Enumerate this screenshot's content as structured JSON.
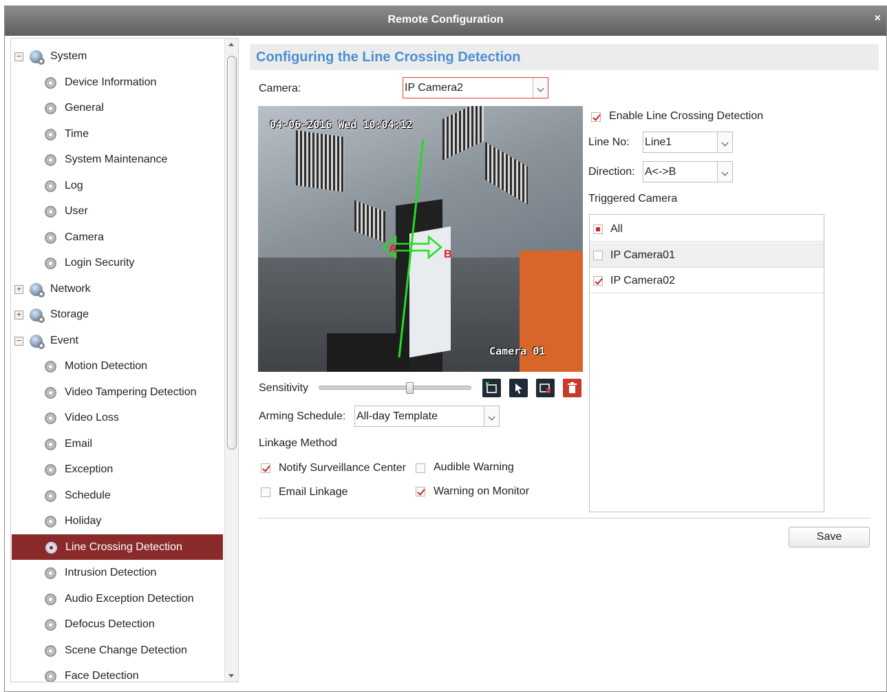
{
  "window": {
    "title": "Remote Configuration",
    "close_label": "×"
  },
  "tree": {
    "items": [
      {
        "label": "System",
        "level": 0,
        "expander": "−",
        "icon": "network-globe-icon"
      },
      {
        "label": "Device Information",
        "level": 1,
        "icon": "settings-gear-icon"
      },
      {
        "label": "General",
        "level": 1,
        "icon": "settings-gear-icon"
      },
      {
        "label": "Time",
        "level": 1,
        "icon": "settings-gear-icon"
      },
      {
        "label": "System Maintenance",
        "level": 1,
        "icon": "settings-gear-icon"
      },
      {
        "label": "Log",
        "level": 1,
        "icon": "settings-gear-icon"
      },
      {
        "label": "User",
        "level": 1,
        "icon": "settings-gear-icon"
      },
      {
        "label": "Camera",
        "level": 1,
        "icon": "settings-gear-icon"
      },
      {
        "label": "Login Security",
        "level": 1,
        "icon": "settings-gear-icon"
      },
      {
        "label": "Network",
        "level": 0,
        "expander": "+",
        "icon": "network-globe-icon"
      },
      {
        "label": "Storage",
        "level": 0,
        "expander": "+",
        "icon": "network-globe-icon"
      },
      {
        "label": "Event",
        "level": 0,
        "expander": "−",
        "icon": "network-globe-icon"
      },
      {
        "label": "Motion Detection",
        "level": 1,
        "icon": "settings-gear-icon"
      },
      {
        "label": "Video Tampering Detection",
        "level": 1,
        "icon": "settings-gear-icon"
      },
      {
        "label": "Video Loss",
        "level": 1,
        "icon": "settings-gear-icon"
      },
      {
        "label": "Email",
        "level": 1,
        "icon": "settings-gear-icon"
      },
      {
        "label": "Exception",
        "level": 1,
        "icon": "settings-gear-icon"
      },
      {
        "label": "Schedule",
        "level": 1,
        "icon": "settings-gear-icon"
      },
      {
        "label": "Holiday",
        "level": 1,
        "icon": "settings-gear-icon"
      },
      {
        "label": "Line Crossing Detection",
        "level": 1,
        "icon": "settings-gear-icon",
        "selected": true
      },
      {
        "label": "Intrusion Detection",
        "level": 1,
        "icon": "settings-gear-icon"
      },
      {
        "label": "Audio Exception Detection",
        "level": 1,
        "icon": "settings-gear-icon"
      },
      {
        "label": "Defocus Detection",
        "level": 1,
        "icon": "settings-gear-icon"
      },
      {
        "label": "Scene Change Detection",
        "level": 1,
        "icon": "settings-gear-icon"
      },
      {
        "label": "Face Detection",
        "level": 1,
        "icon": "settings-gear-icon"
      }
    ]
  },
  "main": {
    "heading": "Configuring the Line Crossing Detection",
    "camera_label": "Camera:",
    "camera_value": "IP Camera2",
    "video": {
      "timestamp": "04-06-2016 Wed 10:04:12",
      "camera_name": "Camera 01",
      "point_a": "A",
      "point_b": "B"
    },
    "sensitivity_label": "Sensitivity",
    "sensitivity_level": 0.6,
    "arming_label": "Arming Schedule:",
    "arming_value": "All-day Template",
    "linkage_label": "Linkage Method",
    "linkage": {
      "notify_label": "Notify Surveillance Center",
      "notify_checked": true,
      "audible_label": "Audible Warning",
      "audible_checked": false,
      "email_label": "Email Linkage",
      "email_checked": false,
      "monitor_label": "Warning on Monitor",
      "monitor_checked": true
    },
    "enable_label": "Enable Line Crossing Detection",
    "enable_checked": true,
    "line_no_label": "Line No:",
    "line_no_value": "Line1",
    "direction_label": "Direction:",
    "direction_value": "A<->B",
    "triggered_label": "Triggered Camera",
    "triggered": [
      {
        "label": "All",
        "state": "partial"
      },
      {
        "label": "IP Camera01",
        "state": "off"
      },
      {
        "label": "IP Camera02",
        "state": "on"
      }
    ],
    "save_label": "Save"
  },
  "colors": {
    "accent": "#4a8fd3",
    "selection": "#8b2a2a",
    "check": "#d02525",
    "line": "#22dd22"
  }
}
